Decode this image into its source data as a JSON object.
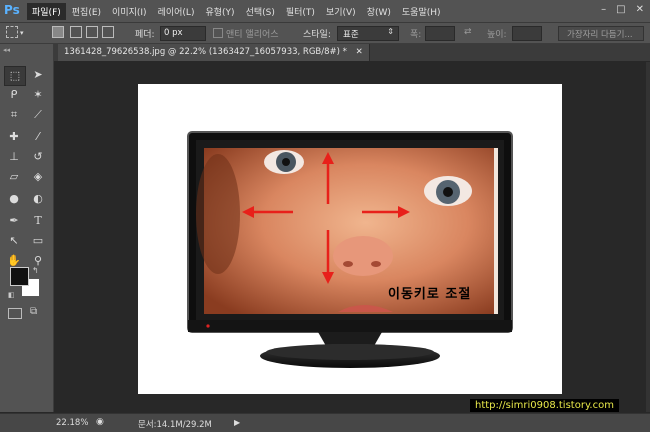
{
  "app": {
    "logo": "Ps"
  },
  "menu": {
    "items": [
      "파일(F)",
      "편집(E)",
      "이미지(I)",
      "레이어(L)",
      "유형(Y)",
      "선택(S)",
      "필터(T)",
      "보기(V)",
      "창(W)",
      "도움말(H)"
    ],
    "window_controls": [
      "–",
      "□",
      "✕"
    ]
  },
  "options": {
    "feather_label": "페더:",
    "feather_value": "0 px",
    "antialias_label": "앤티 앨리어스",
    "style_label": "스타일:",
    "style_value": "표준",
    "width_label": "폭:",
    "height_label": "높이:",
    "refine_edge_button": "가장자리 다듬기..."
  },
  "document": {
    "tab_title": "1361428_79626538.jpg @ 22.2% (1363427_16057933, RGB/8#) *",
    "overlay_text": "이동키로 조절"
  },
  "status": {
    "zoom": "22.18%",
    "doc_size": "문서:14.1M/29.2M"
  },
  "watermark": "http://simri0908.tistory.com",
  "colors": {
    "arrow": "#e8201a",
    "ps_blue": "#5ab2ff",
    "panel": "#535353",
    "canvas_bg": "#282828"
  },
  "icons": [
    "marquee-icon",
    "move-icon",
    "lasso-icon",
    "magic-wand-icon",
    "crop-icon",
    "eyedropper-icon",
    "healing-icon",
    "brush-icon",
    "stamp-icon",
    "history-brush-icon",
    "eraser-icon",
    "paint-bucket-icon",
    "blur-icon",
    "dodge-icon",
    "pen-icon",
    "type-icon",
    "path-select-icon",
    "shape-icon",
    "hand-icon",
    "zoom-icon"
  ]
}
